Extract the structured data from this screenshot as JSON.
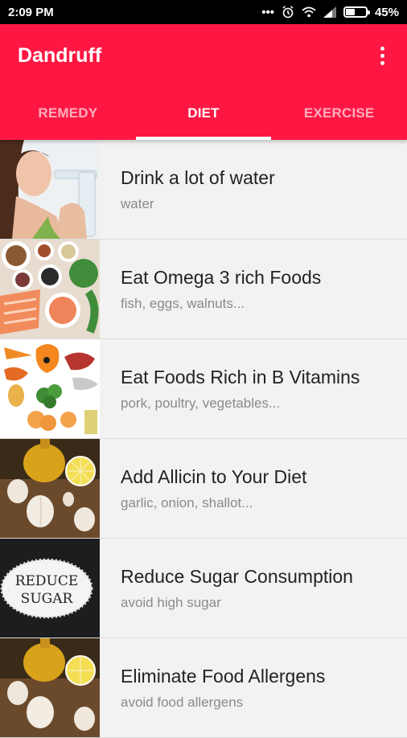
{
  "status": {
    "time": "2:09 PM",
    "battery": "45%",
    "battery_level": 0.45,
    "icons": [
      "more-dots-icon",
      "alarm-icon",
      "wifi-icon",
      "signal-icon",
      "battery-icon"
    ]
  },
  "appbar": {
    "title": "Dandruff",
    "overflow_icon": "more-vert-icon",
    "color": "#ff1744"
  },
  "tabs": [
    {
      "label": "REMEDY",
      "active": false
    },
    {
      "label": "DIET",
      "active": true
    },
    {
      "label": "EXERCISE",
      "active": false
    }
  ],
  "items": [
    {
      "title": "Drink a lot of water",
      "subtitle": "water",
      "image": "woman-drinking-water"
    },
    {
      "title": "Eat Omega 3 rich Foods",
      "subtitle": "fish, eggs, walnuts...",
      "image": "omega-3-foods"
    },
    {
      "title": "Eat Foods Rich in B Vitamins",
      "subtitle": "pork, poultry, vegetables...",
      "image": "b-vitamin-foods"
    },
    {
      "title": "Add Allicin to Your Diet",
      "subtitle": "garlic, onion, shallot...",
      "image": "garlic-and-oil"
    },
    {
      "title": "Reduce Sugar Consumption",
      "subtitle": "avoid high sugar",
      "image": "reduce-sugar",
      "image_text": "REDUCE SUGAR"
    },
    {
      "title": "Eliminate Food Allergens",
      "subtitle": "avoid food allergens",
      "image": "garlic-and-oil"
    }
  ]
}
